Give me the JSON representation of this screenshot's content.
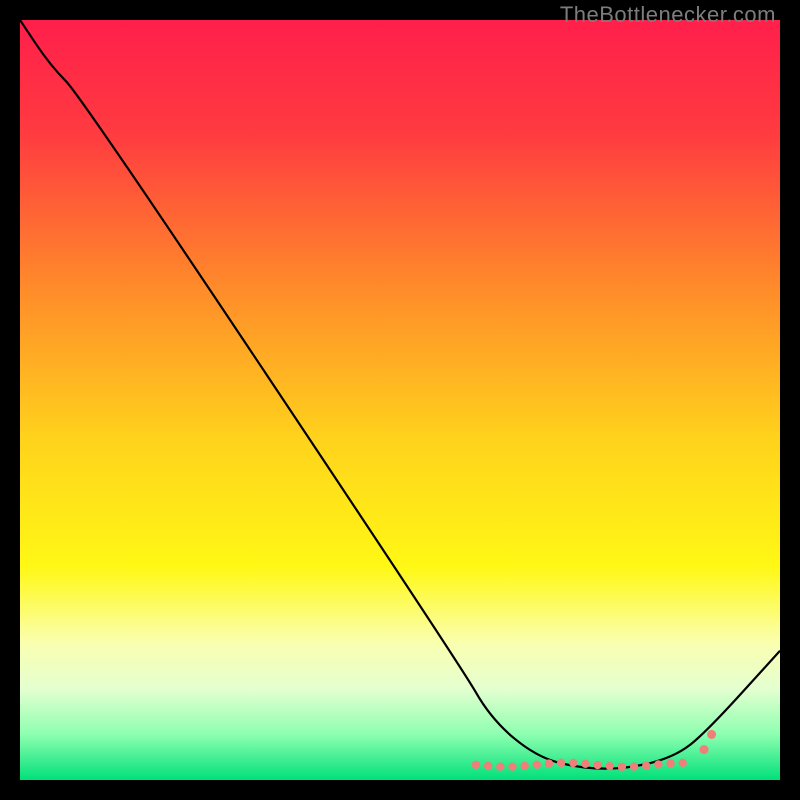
{
  "watermark": "TheBottlenecker.com",
  "chart_data": {
    "type": "line",
    "title": "",
    "xlabel": "",
    "ylabel": "",
    "xlim": [
      0,
      100
    ],
    "ylim": [
      0,
      100
    ],
    "gradient_stops": [
      {
        "offset": 0,
        "color": "#ff1f4b"
      },
      {
        "offset": 15,
        "color": "#ff3b40"
      },
      {
        "offset": 35,
        "color": "#ff8a2a"
      },
      {
        "offset": 55,
        "color": "#ffd21c"
      },
      {
        "offset": 72,
        "color": "#fff815"
      },
      {
        "offset": 82,
        "color": "#faffb0"
      },
      {
        "offset": 88,
        "color": "#e4ffd0"
      },
      {
        "offset": 94,
        "color": "#8dffb0"
      },
      {
        "offset": 100,
        "color": "#00e07a"
      }
    ],
    "series": [
      {
        "name": "bottleneck-curve",
        "points": [
          {
            "x": 0,
            "y": 100
          },
          {
            "x": 4,
            "y": 94
          },
          {
            "x": 8,
            "y": 90
          },
          {
            "x": 58,
            "y": 15
          },
          {
            "x": 62,
            "y": 8
          },
          {
            "x": 68,
            "y": 3
          },
          {
            "x": 74,
            "y": 1.5
          },
          {
            "x": 80,
            "y": 1.5
          },
          {
            "x": 86,
            "y": 3
          },
          {
            "x": 90,
            "y": 6
          },
          {
            "x": 100,
            "y": 17
          }
        ]
      }
    ],
    "flat_zone_markers": {
      "y": 2,
      "x_start": 60,
      "x_end": 88,
      "extra": [
        90,
        91
      ]
    }
  }
}
